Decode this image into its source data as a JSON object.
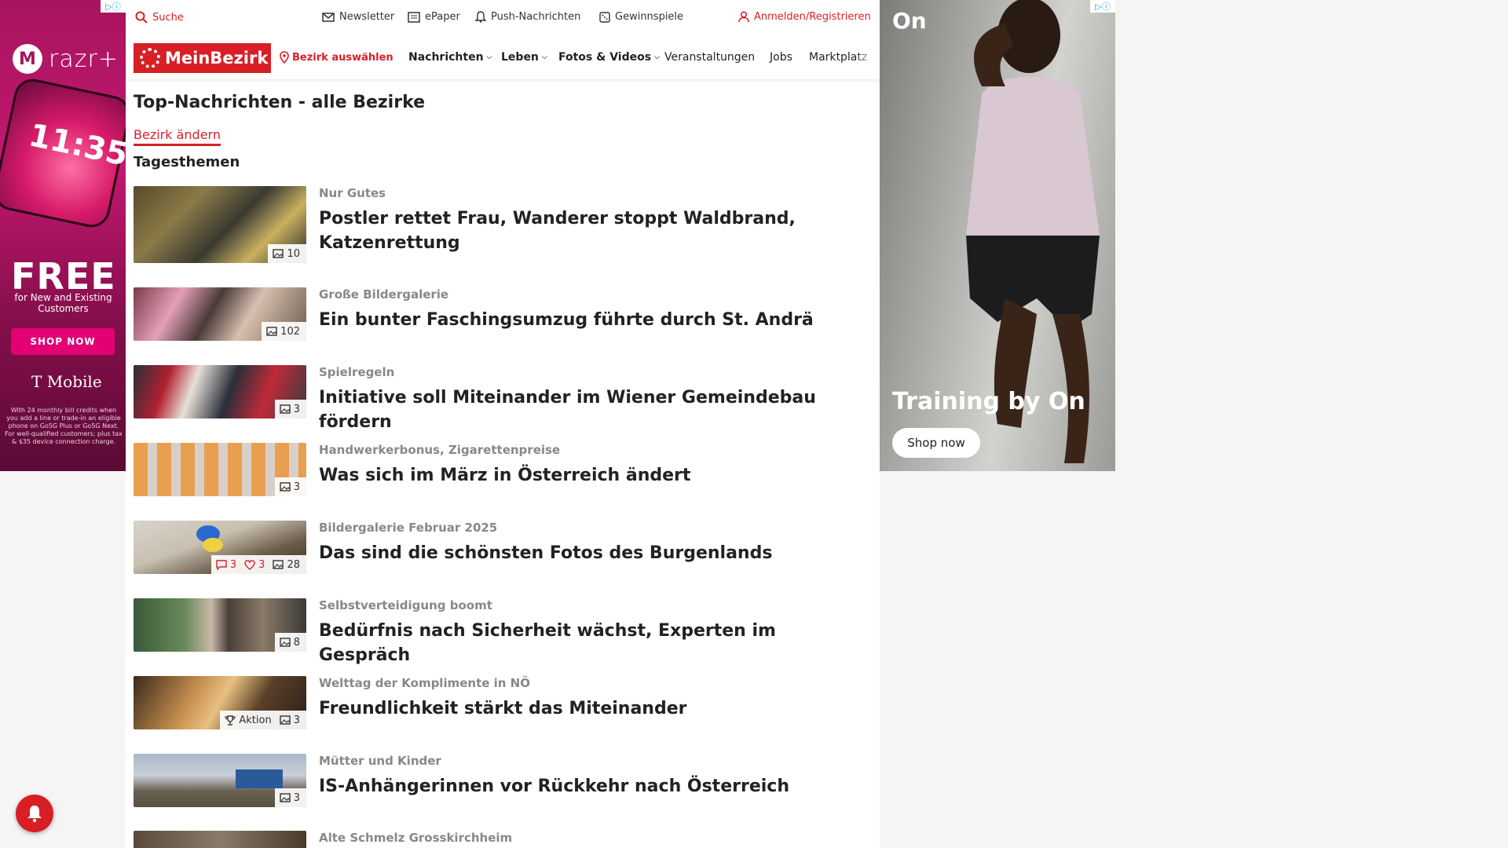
{
  "ads": {
    "left": {
      "brand": "razr+",
      "time": "11:35",
      "headline": "FREE",
      "subline": "for New and Existing Customers",
      "cta": "SHOP NOW",
      "carrier": "T Mobile",
      "fineprint": "With 24 monthly bill credits when you add a line or trade-in an eligible phone on Go5G Plus or Go5G Next. For well-qualified customers; plus tax & $35 device connection charge."
    },
    "right": {
      "logo": "On",
      "headline": "Training by On",
      "cta": "Shop now"
    }
  },
  "topbar": {
    "search": "Suche",
    "newsletter": "Newsletter",
    "epaper": "ePaper",
    "push": "Push-Nachrichten",
    "gewinnspiele": "Gewinnspiele",
    "login": "Anmelden/Registrieren"
  },
  "nav": {
    "logo": "MeinBezirk",
    "bezirk": "Bezirk auswählen",
    "items": [
      "Nachrichten",
      "Leben",
      "Fotos & Videos",
      "Veranstaltungen",
      "Jobs",
      "Marktplatz"
    ]
  },
  "page": {
    "title": "Top-Nachrichten - alle Bezirke",
    "change_link": "Bezirk ändern",
    "section": "Tagesthemen"
  },
  "articles": [
    {
      "kicker": "Nur Gutes",
      "headline": "Postler rettet Frau, Wanderer stoppt Waldbrand, Katzenrettung",
      "images": "10"
    },
    {
      "kicker": "Große Bildergalerie",
      "headline": "Ein bunter Faschingsumzug führte durch St. Andrä",
      "images": "102"
    },
    {
      "kicker": "Spielregeln",
      "headline": "Initiative soll Miteinander im Wiener Gemeindebau fördern",
      "images": "3"
    },
    {
      "kicker": "Handwerkerbonus, Zigarettenpreise",
      "headline": "Was sich im März in Österreich ändert",
      "images": "3"
    },
    {
      "kicker": "Bildergalerie Februar 2025",
      "headline": "Das sind die schönsten Fotos des Burgenlands",
      "images": "28",
      "comments": "3",
      "likes": "3"
    },
    {
      "kicker": "Selbstverteidigung boomt",
      "headline": "Bedürfnis nach Sicherheit wächst, Experten im Gespräch",
      "images": "8"
    },
    {
      "kicker": "Welttag der Komplimente in NÖ",
      "headline": "Freundlichkeit stärkt das Miteinander",
      "images": "3",
      "tag": "Aktion"
    },
    {
      "kicker": "Mütter und Kinder",
      "headline": "IS-Anhängerinnen vor Rückkehr nach Österreich",
      "images": "3"
    },
    {
      "kicker": "Alte Schmelz Grosskirchheim",
      "headline": "",
      "images": ""
    }
  ],
  "colors": {
    "brand_red": "#d81f26",
    "kicker_gray": "#888888"
  }
}
